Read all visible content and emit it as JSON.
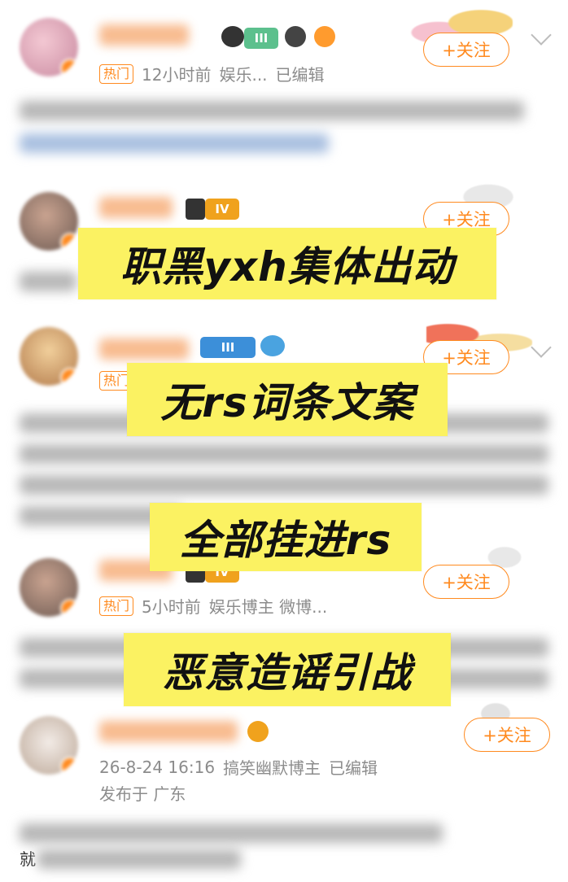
{
  "feed": {
    "posts": [
      {
        "hot_label": "热门",
        "time": "12小时前",
        "category": "娱乐...",
        "edited": "已编辑",
        "follow": "+关注",
        "level": "III"
      },
      {
        "follow": "+关注",
        "level": "IV"
      },
      {
        "hot_label": "热门",
        "follow": "+关注",
        "level": "III"
      },
      {
        "hot_label": "热门",
        "time": "5小时前",
        "category": "娱乐博主 微博...",
        "follow": "+关注",
        "level": "IV"
      },
      {
        "time": "26-8-24 16:16",
        "category": "搞笑幽默博主",
        "edited": "已编辑",
        "location": "发布于 广东",
        "follow": "+关注",
        "body_visible_start": "就"
      }
    ]
  },
  "captions": {
    "line1": "职黑yxh集体出动",
    "line2": "无rs词条文案",
    "line3": "全部挂进rs",
    "line4": "恶意造谣引战"
  },
  "colors": {
    "accent": "#ff8a1f",
    "caption_bg": "#fbf262",
    "meta_text": "#8c8c8c"
  }
}
